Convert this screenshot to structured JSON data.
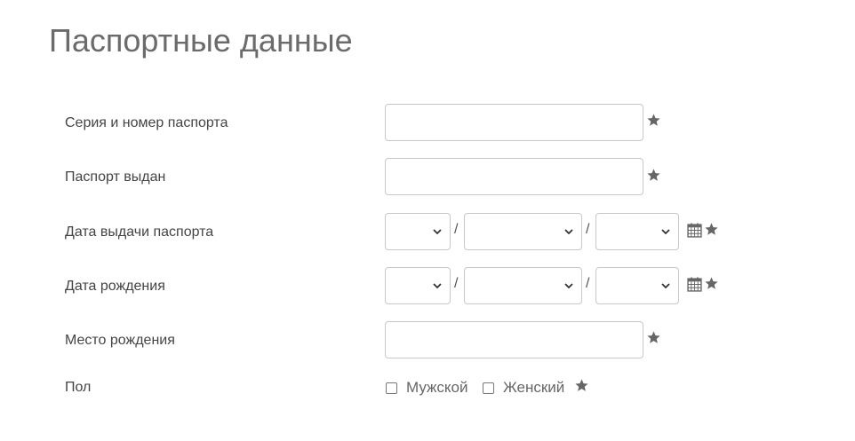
{
  "page": {
    "title": "Паспортные данные"
  },
  "fields": {
    "passport_number": {
      "label": "Серия и номер паспорта",
      "value": ""
    },
    "passport_issued_by": {
      "label": "Паспорт выдан",
      "value": ""
    },
    "passport_issue_date": {
      "label": "Дата выдачи паспорта",
      "day": "",
      "month": "",
      "year": "",
      "separator": "/"
    },
    "birth_date": {
      "label": "Дата рождения",
      "day": "",
      "month": "",
      "year": "",
      "separator": "/"
    },
    "birth_place": {
      "label": "Место рождения",
      "value": ""
    },
    "gender": {
      "label": "Пол",
      "options": [
        {
          "label": "Мужской",
          "checked": false
        },
        {
          "label": "Женский",
          "checked": false
        }
      ]
    }
  },
  "icons": {
    "required": "star-icon",
    "calendar": "calendar-icon",
    "dropdown": "chevron-down-icon"
  },
  "colors": {
    "icon": "#666666",
    "border": "#c8c8c8",
    "title": "#6b6b6b"
  }
}
